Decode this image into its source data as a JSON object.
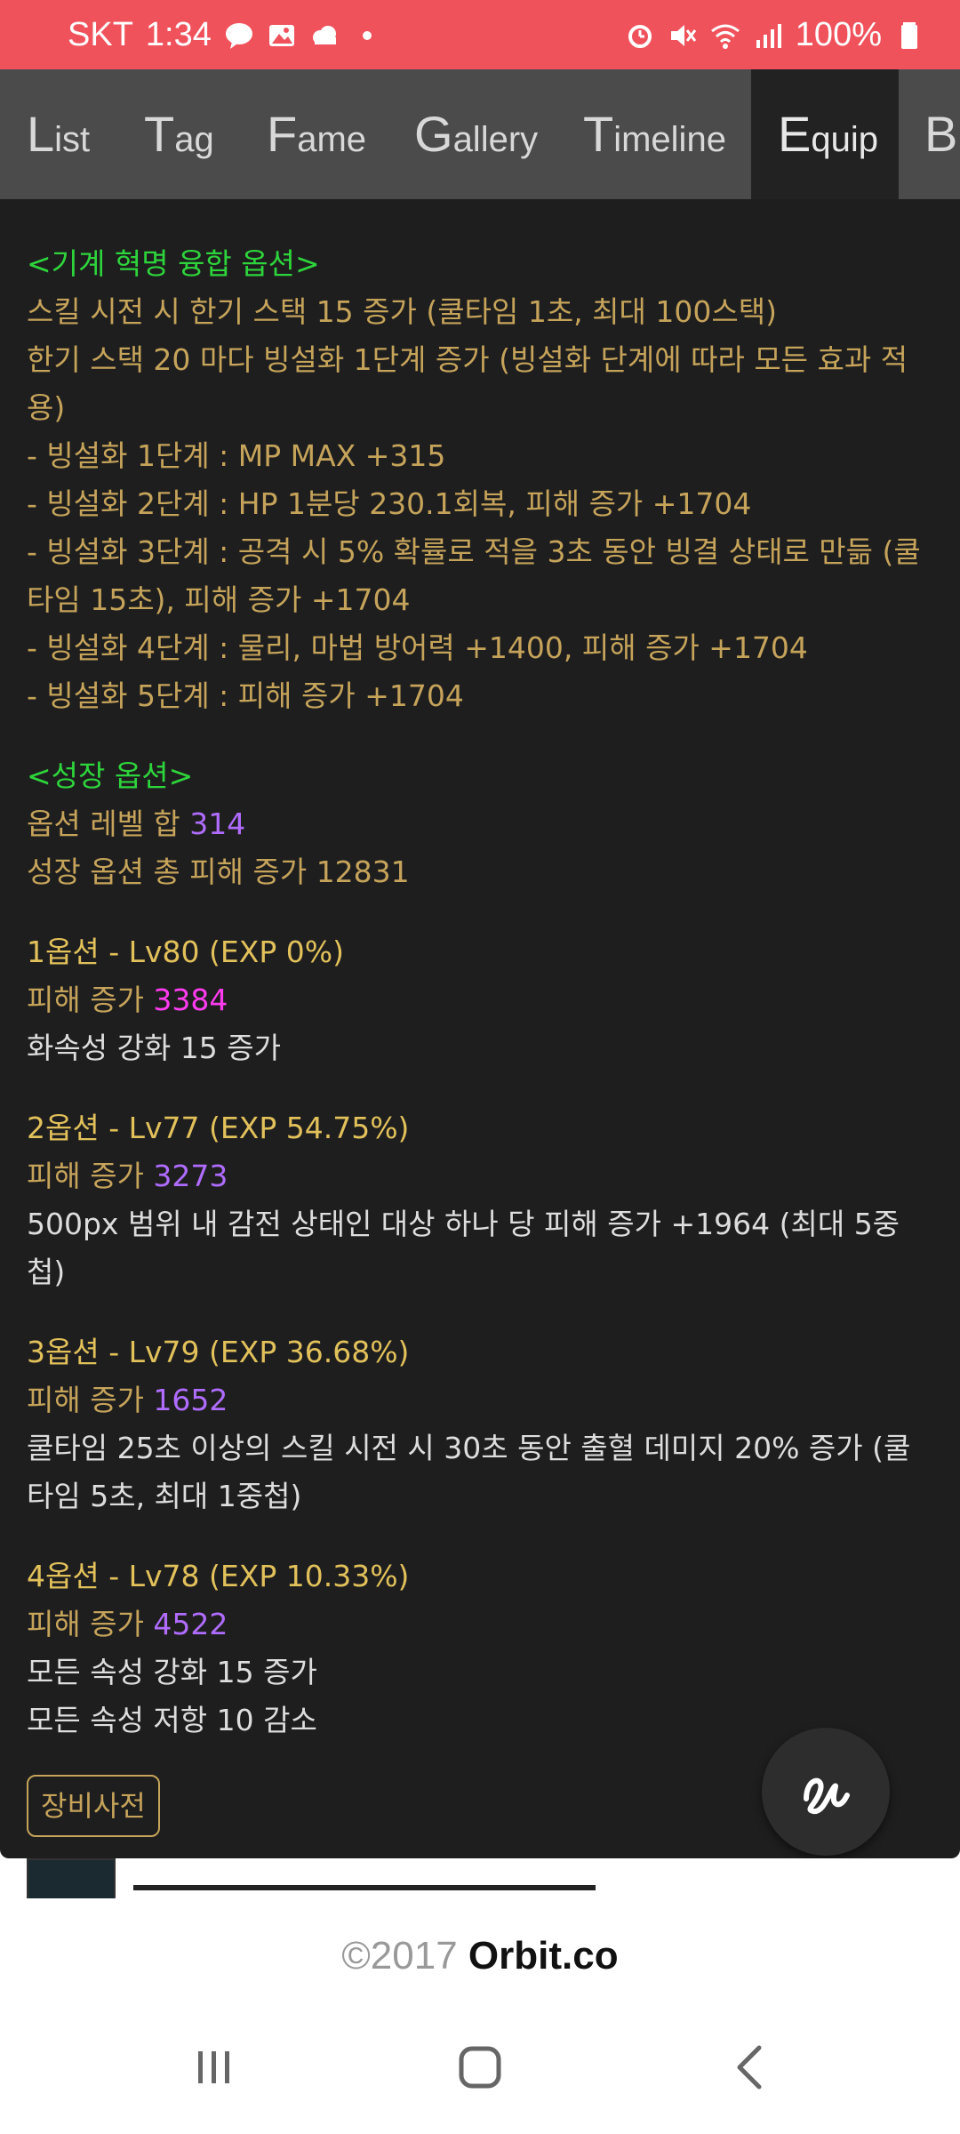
{
  "status_bar": {
    "carrier": "SKT",
    "time": "1:34",
    "battery": "100%",
    "icons_left": [
      "talk-icon",
      "gallery-icon",
      "cloud-icon",
      "dot-icon"
    ],
    "icons_right": [
      "alarm-icon",
      "mute-icon",
      "wifi-icon",
      "signal-icon",
      "battery-icon"
    ]
  },
  "tabs": [
    {
      "cap": "L",
      "rest": "ist"
    },
    {
      "cap": "T",
      "rest": "ag"
    },
    {
      "cap": "F",
      "rest": "ame"
    },
    {
      "cap": "G",
      "rest": "allery"
    },
    {
      "cap": "T",
      "rest": "imeline"
    },
    {
      "cap": "E",
      "rest": "quip"
    },
    {
      "cap": "B",
      "rest": ""
    }
  ],
  "active_tab": "Equip",
  "fusion": {
    "header": "<기계 혁명 융합 옵션>",
    "lines": [
      "스킬 시전 시 한기 스택 15 증가 (쿨타임 1초, 최대 100스택)",
      "한기 스택 20 마다 빙설화 1단계 증가 (빙설화 단계에 따라 모든 효과 적용)",
      "- 빙설화 1단계 : MP MAX +315",
      "- 빙설화 2단계 : HP 1분당 230.1회복, 피해 증가 +1704",
      "- 빙설화 3단계 : 공격 시 5% 확률로 적을 3초 동안 빙결 상태로 만듦 (쿨타임 15초), 피해 증가 +1704",
      "- 빙설화 4단계 : 물리, 마법 방어력 +1400, 피해 증가 +1704",
      "- 빙설화 5단계 : 피해 증가 +1704"
    ]
  },
  "growth": {
    "header": "<성장 옵션>",
    "level_sum_label": "옵션 레벨 합 ",
    "level_sum_value": "314",
    "total_damage": "성장 옵션 총 피해 증가 12831"
  },
  "options": [
    {
      "title": "1옵션 - Lv80 (EXP 0%)",
      "damage_label": "피해 증가 ",
      "damage_value": "3384",
      "highlight": "magenta",
      "desc": [
        "화속성 강화 15 증가"
      ]
    },
    {
      "title": "2옵션 - Lv77 (EXP 54.75%)",
      "damage_label": "피해 증가 ",
      "damage_value": "3273",
      "highlight": "purple",
      "desc": [
        "500px 범위 내 감전 상태인 대상 하나 당 피해 증가 +1964 (최대 5중첩)"
      ]
    },
    {
      "title": "3옵션 - Lv79 (EXP 36.68%)",
      "damage_label": "피해 증가 ",
      "damage_value": "1652",
      "highlight": "purple",
      "desc": [
        "쿨타임 25초 이상의 스킬 시전 시 30초 동안 출혈 데미지 20% 증가 (쿨타임 5초, 최대 1중첩)"
      ]
    },
    {
      "title": "4옵션 - Lv78 (EXP 10.33%)",
      "damage_label": "피해 증가 ",
      "damage_value": "4522",
      "highlight": "purple",
      "desc": [
        "모든 속성 강화 15 증가",
        "모든 속성 저항 10 감소"
      ]
    }
  ],
  "equip_dict_button": "장비사전",
  "fab_icon": "script-icon",
  "footer": {
    "copyright": "©2017 ",
    "brand": "Orbit.co"
  },
  "nav": [
    "recents-icon",
    "home-icon",
    "back-icon"
  ],
  "colors": {
    "status_bar": "#f0525c",
    "panel_bg": "#1e1e1e",
    "header_green": "#2ed43c",
    "text_gold": "#c5a35a",
    "title_yellow": "#e2c15b",
    "value_purple": "#b06cff",
    "value_magenta": "#ff3cf0"
  }
}
